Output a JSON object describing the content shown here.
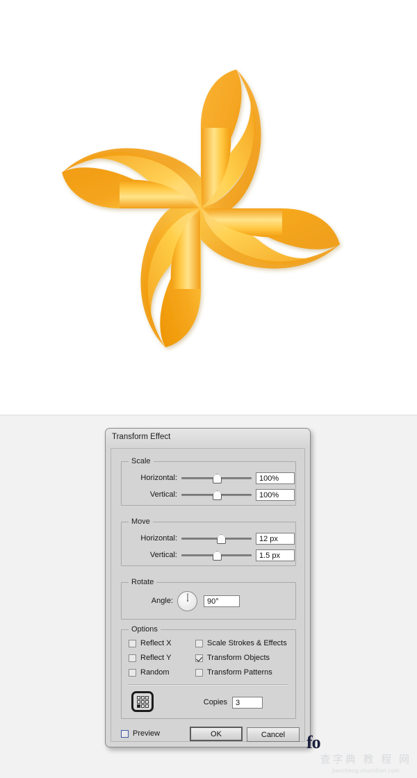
{
  "illustration": {
    "name": "pinwheel-illustration",
    "description": "Orange four-blade pinwheel",
    "colors": {
      "blade_orange": "#F5A623",
      "blade_deep": "#F29200",
      "blade_highlight": "#FFE27A",
      "blade_light": "#FFD24A",
      "background": "#FFFFFF"
    }
  },
  "dialog": {
    "title": "Transform Effect",
    "groups": {
      "scale": {
        "legend": "Scale",
        "rows": [
          {
            "label": "Horizontal:",
            "value": "100%",
            "thumb_pct": 50
          },
          {
            "label": "Vertical:",
            "value": "100%",
            "thumb_pct": 50
          }
        ]
      },
      "move": {
        "legend": "Move",
        "rows": [
          {
            "label": "Horizontal:",
            "value": "12 px",
            "thumb_pct": 56
          },
          {
            "label": "Vertical:",
            "value": "1.5 px",
            "thumb_pct": 50
          }
        ]
      },
      "rotate": {
        "legend": "Rotate",
        "label": "Angle:",
        "value": "90°",
        "dial_angle": 0
      },
      "options": {
        "legend": "Options",
        "checkboxes": [
          {
            "label": "Reflect X",
            "checked": false
          },
          {
            "label": "Reflect Y",
            "checked": false
          },
          {
            "label": "Random",
            "checked": false
          },
          {
            "label": "Scale Strokes & Effects",
            "checked": false
          },
          {
            "label": "Transform Objects",
            "checked": true
          },
          {
            "label": "Transform Patterns",
            "checked": false
          }
        ],
        "anchor": {
          "name": "reference-point-selector",
          "selected_cell": "bottom-left"
        },
        "copies": {
          "label": "Copies",
          "value": "3"
        }
      }
    },
    "footer": {
      "preview": {
        "label": "Preview",
        "checked": false
      },
      "ok": "OK",
      "cancel": "Cancel"
    }
  },
  "watermark": {
    "cn": "查字典 教 程 网",
    "url": "jiaocheng.chazidian.com",
    "corner_glyph": "fo"
  }
}
